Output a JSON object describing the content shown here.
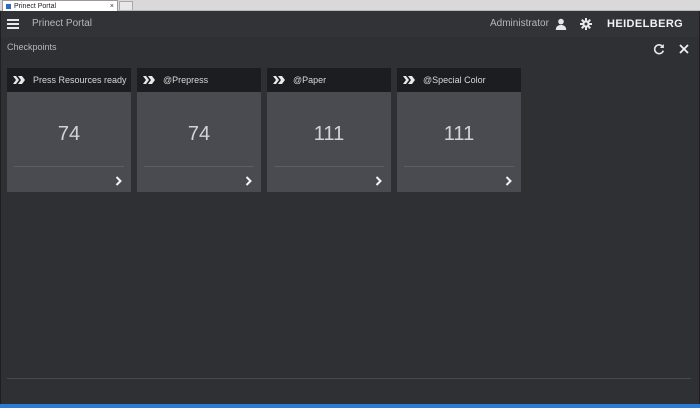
{
  "browser": {
    "tab_title": "Prinect Portal",
    "tab_close": "×"
  },
  "header": {
    "menu_icon": "hamburger-menu-icon",
    "app_title": "Prinect Portal",
    "user_name": "Administrator",
    "user_icon": "user-icon",
    "settings_icon": "gear-icon",
    "logo_text": "HEIDELBERG"
  },
  "page": {
    "section_title": "Checkpoints",
    "refresh_icon": "refresh-icon",
    "close_icon": "close-icon"
  },
  "cards": [
    {
      "title": "Press Resources ready",
      "count": "74"
    },
    {
      "title": "@Prepress",
      "count": "74"
    },
    {
      "title": "@Paper",
      "count": "111"
    },
    {
      "title": "@Special Color",
      "count": "111"
    }
  ],
  "colors": {
    "background": "#2f3034",
    "card": "#4a4b51",
    "card_header": "#1c1d20",
    "accent_bar": "#2d7bd6"
  }
}
